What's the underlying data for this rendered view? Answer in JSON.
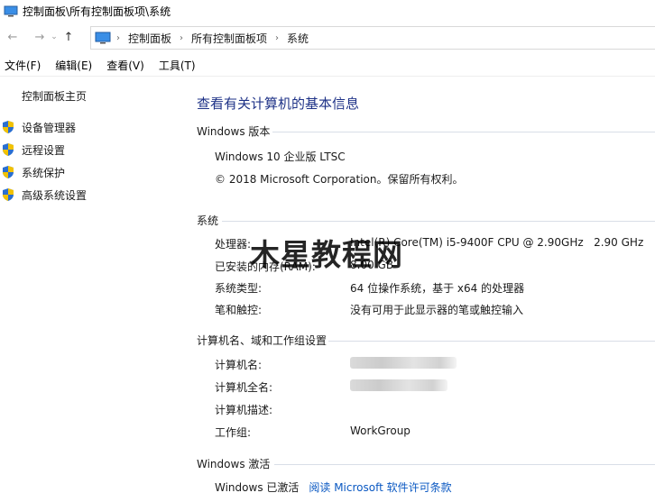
{
  "window": {
    "title": "控制面板\\所有控制面板项\\系统"
  },
  "address": {
    "crumbs": [
      "控制面板",
      "所有控制面板项",
      "系统"
    ]
  },
  "menu": [
    "文件(F)",
    "编辑(E)",
    "查看(V)",
    "工具(T)"
  ],
  "sidebar": {
    "home": "控制面板主页",
    "items": [
      "设备管理器",
      "远程设置",
      "系统保护",
      "高级系统设置"
    ]
  },
  "main": {
    "heading": "查看有关计算机的基本信息",
    "windows_edition": {
      "title": "Windows 版本",
      "edition": "Windows 10 企业版 LTSC",
      "copyright": "© 2018 Microsoft Corporation。保留所有权利。"
    },
    "system": {
      "title": "系统",
      "rows": [
        {
          "label": "处理器:",
          "value": "Intel(R) Core(TM) i5-9400F CPU @ 2.90GHz   2.90 GHz"
        },
        {
          "label": "已安装的内存(RAM):",
          "value": "8.00 GB"
        },
        {
          "label": "系统类型:",
          "value": "64 位操作系统，基于 x64 的处理器"
        },
        {
          "label": "笔和触控:",
          "value": "没有可用于此显示器的笔或触控输入"
        }
      ]
    },
    "computer": {
      "title": "计算机名、域和工作组设置",
      "rows": [
        {
          "label": "计算机名:",
          "value": ""
        },
        {
          "label": "计算机全名:",
          "value": ""
        },
        {
          "label": "计算机描述:",
          "value": ""
        },
        {
          "label": "工作组:",
          "value": "WorkGroup"
        }
      ]
    },
    "activation": {
      "title": "Windows 激活",
      "status": "Windows 已激活",
      "link": "阅读 Microsoft 软件许可条款"
    }
  },
  "watermark": "木星教程网",
  "colors": {
    "heading": "#1e3287",
    "link": "#0a58c2",
    "shield_blue": "#2a6fd1",
    "shield_yellow": "#f2c200"
  }
}
